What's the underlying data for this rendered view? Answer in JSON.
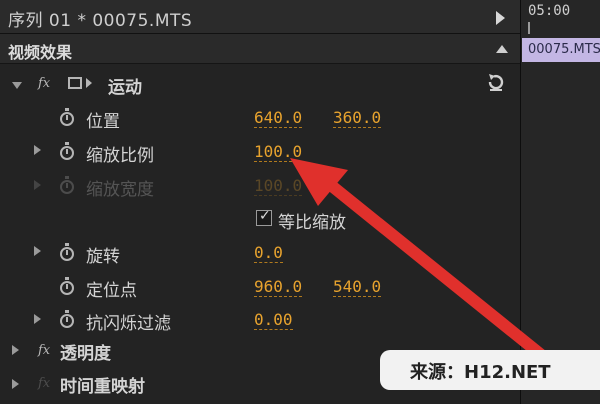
{
  "header": {
    "sequence_title": "序列 01 * 00075.MTS"
  },
  "timeline": {
    "time": "05:00",
    "clip_name": "00075.MTS"
  },
  "panel": {
    "title": "视频效果",
    "motion": {
      "fx": "fx",
      "label": "运动",
      "position": {
        "label": "位置",
        "x": "640.0",
        "y": "360.0"
      },
      "scale": {
        "label": "缩放比例",
        "value": "100.0"
      },
      "scale_width": {
        "label": "缩放宽度",
        "value": "100.0"
      },
      "uniform_scale": {
        "label": "等比缩放",
        "checked": true
      },
      "rotation": {
        "label": "旋转",
        "value": "0.0"
      },
      "anchor": {
        "label": "定位点",
        "x": "960.0",
        "y": "540.0"
      },
      "anti_flicker": {
        "label": "抗闪烁过滤",
        "value": "0.00"
      }
    },
    "opacity": {
      "fx": "fx",
      "label": "透明度"
    },
    "time_remap": {
      "fx": "fx",
      "label": "时间重映射"
    }
  },
  "watermark": {
    "text": "来源：H12.NET"
  },
  "colors": {
    "value": "#e8a32e",
    "arrow": "#e0302c",
    "clip": "#c3b6e4"
  }
}
